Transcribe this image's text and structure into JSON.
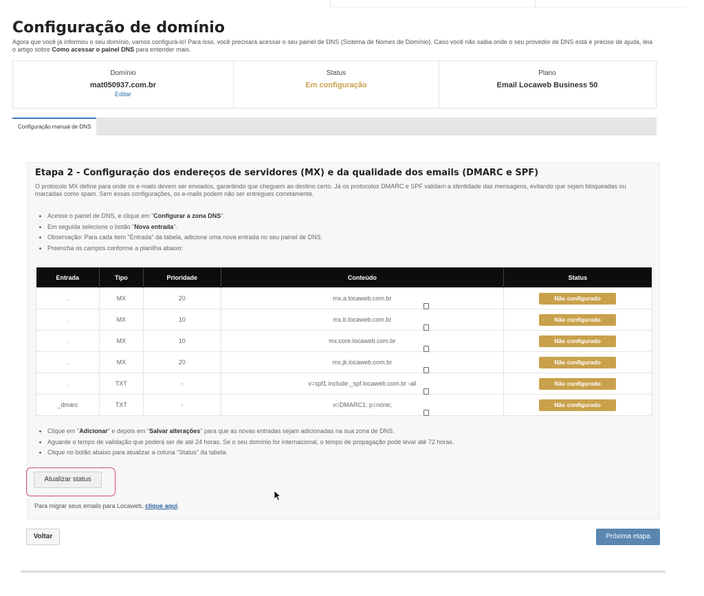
{
  "page": {
    "title": "Configuração de domínio",
    "intro_text": "Agora que você já informou o seu domínio, vamos configurá-lo! Para isso, você precisará acessar o seu painel de DNS (Sistema de Nomes de Domínio). Caso você não saiba onde o seu provedor de DNS está e precise de ajuda, leia o artigo sobre ",
    "intro_link": "Como acessar o painel DNS",
    "intro_suffix": " para entender mais."
  },
  "summary": {
    "domain_label": "Domínio",
    "domain_value": "mat050937.com.br",
    "edit_label": "Editar",
    "status_label": "Status",
    "status_value": "Em configuração",
    "plan_label": "Plano",
    "plan_value": "Email Locaweb Business 50"
  },
  "tabs": [
    {
      "label": "Configuração manual de DNS"
    }
  ],
  "step": {
    "title": "Etapa 2 - Configuração dos endereços de servidores (MX) e da qualidade dos emails (DMARC e SPF)",
    "description": "O protocolo MX define para onde os e-mails devem ser enviados, garantindo que cheguem ao destino certo. Já os protocolos DMARC e SPF validam a identidade das mensagens, evitando que sejam bloqueadas ou marcadas como spam. Sem essas configurações, os e-mails podem não ser entregues corretamente.",
    "instructions": [
      {
        "prefix": "Acesse o painel de DNS, e clique em \"",
        "bold": "Configurar a zona DNS",
        "suffix": "\"."
      },
      {
        "prefix": "Em seguida selecione o botão \"",
        "bold": "Nova entrada",
        "suffix": "\"."
      },
      {
        "prefix": "Observação: Para cada item \"Entrada\" da tabela, adicione uma nova entrada no seu painel de DNS.",
        "bold": "",
        "suffix": ""
      },
      {
        "prefix": "Preencha os campos conforme a planilha abaixo:",
        "bold": "",
        "suffix": ""
      }
    ],
    "table": {
      "headers": {
        "entrada": "Entrada",
        "tipo": "Tipo",
        "prioridade": "Prioridade",
        "conteudo": "Conteúdo",
        "status": "Status"
      },
      "rows": [
        {
          "entrada": ".",
          "tipo": "MX",
          "prioridade": "20",
          "conteudo": "mx.a.locaweb.com.br",
          "status": "Não configurado"
        },
        {
          "entrada": ".",
          "tipo": "MX",
          "prioridade": "10",
          "conteudo": "mx.b.locaweb.com.br",
          "status": "Não configurado"
        },
        {
          "entrada": ".",
          "tipo": "MX",
          "prioridade": "10",
          "conteudo": "mx.core.locaweb.com.br",
          "status": "Não configurado"
        },
        {
          "entrada": ".",
          "tipo": "MX",
          "prioridade": "20",
          "conteudo": "mx.jk.locaweb.com.br",
          "status": "Não configurado"
        },
        {
          "entrada": ".",
          "tipo": "TXT",
          "prioridade": "-",
          "conteudo": "v=spf1 include:_spf.locaweb.com.br -all",
          "status": "Não configurado"
        },
        {
          "entrada": "_dmarc",
          "tipo": "TXT",
          "prioridade": "-",
          "conteudo": "v=DMARC1; p=none;",
          "status": "Não configurado"
        }
      ]
    },
    "after_instructions": [
      {
        "p1": "Clique em \"",
        "b1": "Adicionar",
        "p2": "\" e depois em \"",
        "b2": "Salvar alterações",
        "p3": "\" para que as novas entradas sejam adicionadas na sua zona de DNS."
      },
      {
        "p1": "Aguarde o tempo de validação que poderá ser de até 24 horas. Se o seu domínio for internacional, o tempo de propagação pode levar até 72 horas.",
        "b1": "",
        "p2": "",
        "b2": "",
        "p3": ""
      },
      {
        "p1": "Clique no botão abaixo para atualizar a coluna \"Status\" da tabela.",
        "b1": "",
        "p2": "",
        "b2": "",
        "p3": ""
      }
    ],
    "update_button": "Atualizar status",
    "migrate_text": "Para migrar seus emails para Locaweb, ",
    "migrate_link": "clique aqui",
    "migrate_suffix": "."
  },
  "nav": {
    "back_label": "Voltar",
    "next_label": "Próxima etapa"
  },
  "colors": {
    "status_gold": "#c9a14c",
    "primary_blue": "#5a86b0",
    "highlight": "#d14a6b",
    "table_header": "#0d0d0d"
  }
}
